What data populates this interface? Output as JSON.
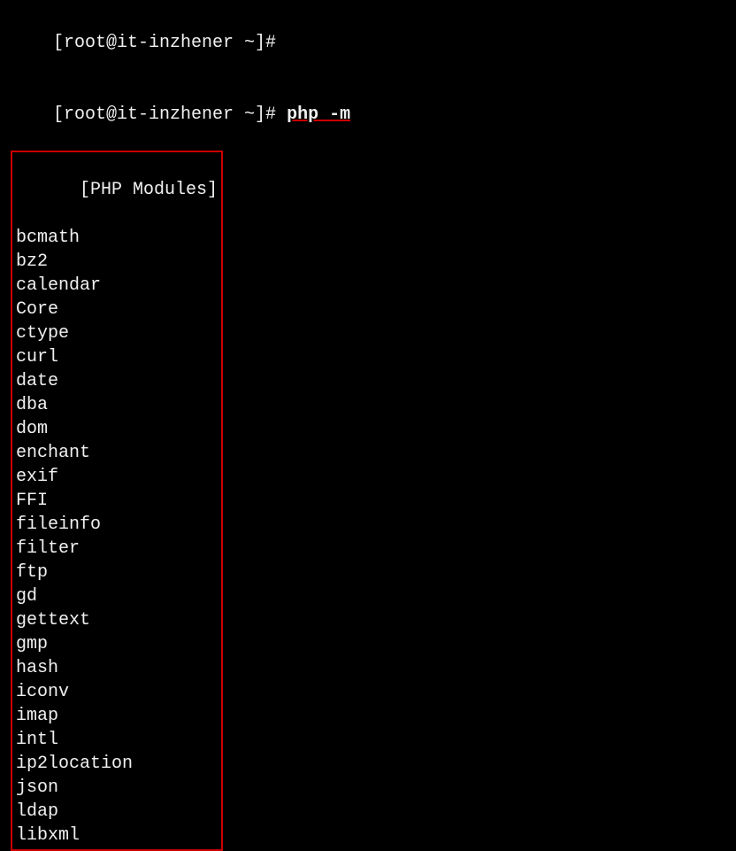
{
  "terminal": {
    "lines": [
      {
        "id": "prompt1",
        "text": "[root@it-inzhener ~]#"
      },
      {
        "id": "prompt2",
        "text": "[root@it-inzhener ~]# php -m"
      },
      {
        "id": "header",
        "text": "[PHP Modules]"
      }
    ],
    "modules": [
      "bcmath",
      "bz2",
      "calendar",
      "Core",
      "ctype",
      "curl",
      "date",
      "dba",
      "dom",
      "enchant",
      "exif",
      "FFI",
      "fileinfo",
      "filter",
      "ftp",
      "gd",
      "gettext",
      "gmp",
      "hash",
      "iconv",
      "imap",
      "intl",
      "ip2location",
      "json",
      "ldap",
      "libxml"
    ],
    "command_text": "php -m",
    "command_underline": "php -m"
  }
}
